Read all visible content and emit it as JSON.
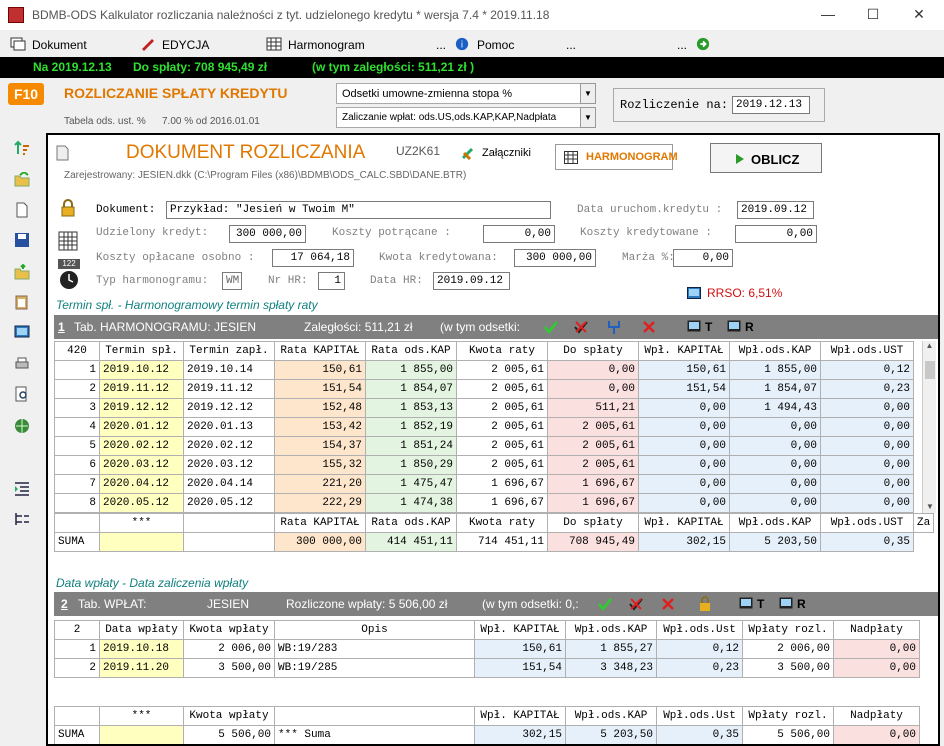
{
  "window": {
    "title": "BDMB-ODS Kalkulator rozliczania należności z tyt. udzielonego kredytu * wersja 7.4 * 2019.11.18",
    "min": "—",
    "max": "☐",
    "close": "✕"
  },
  "menu": {
    "dokument": "Dokument",
    "edycja": "EDYCJA",
    "harmonogram": "Harmonogram",
    "dots1": "...",
    "pomoc": "Pomoc",
    "dots2": "...",
    "dots3": "..."
  },
  "status": {
    "date": "Na 2019.12.13",
    "do_splaty": "Do spłaty: 708 945,49 zł",
    "zaleglosci": "(w tym zaległości: 511,21 zł )"
  },
  "header": {
    "f10": "F10",
    "title": "ROZLICZANIE SPŁATY KREDYTU",
    "odsetki_combo": "Odsetki umowne-zmienna stopa %",
    "zaliczanie_combo": "Zaliczanie wpłat: ods.US,ods.KAP,KAP,Nadpłata",
    "tabela_label": "Tabela ods. ust. %",
    "tabela_value": "7.00 % od 2016.01.01",
    "rozliczenie_label": "Rozliczenie na:",
    "rozliczenie_value": "2019.12.13"
  },
  "doc": {
    "title": "DOKUMENT ROZLICZANIA",
    "code": "UZ2K61",
    "zalaczniki": "Załączniki",
    "harmonogram_btn": "HARMONOGRAM",
    "oblicz_btn": "OBLICZ",
    "registered": "Zarejestrowany: JESIEN.dkk (C:\\Program Files (x86)\\BDMB\\ODS_CALC.SBD\\DANE.BTR)"
  },
  "form": {
    "dokument_label": "Dokument:",
    "dokument_value": "Przykład: \"Jesień w Twoim M\"",
    "data_uruch_label": "Data uruchom.kredytu :",
    "data_uruch_value": "2019.09.12",
    "udzielony_label": "Udzielony kredyt:",
    "udzielony_value": "300 000,00",
    "koszty_potr_label": "Koszty potrącane  :",
    "koszty_potr_value": "0,00",
    "koszty_kred_label": "Koszty kredytowane :",
    "koszty_kred_value": "0,00",
    "koszty_opl_label": "Koszty opłacane osobno :",
    "koszty_opl_value": "17 064,18",
    "kwota_kred_label": "Kwota kredytowana:",
    "kwota_kred_value": "300 000,00",
    "marza_label": "Marża %:",
    "marza_value": "0,00",
    "typ_label": "Typ harmonogramu:",
    "typ_value": "WM",
    "nr_label": "Nr HR:",
    "nr_value": "1",
    "data_hr_label": "Data HR:",
    "data_hr_value": "2019.09.12",
    "rrso": "RRSO: 6,51%",
    "calc_icon_text": "122"
  },
  "harm": {
    "caption": "Termin spł. -   Harmonogramowy termin spłaty raty",
    "num": "1",
    "title": "Tab. HARMONOGRAMU:  JESIEN",
    "zal": "Zaległości: 511,21 zł",
    "odsetki": "(w tym odsetki:",
    "t": "T",
    "r": "R",
    "headers": [
      "420",
      "Termin spł.",
      "Termin zapł.",
      "Rata KAPITAŁ",
      "Rata ods.KAP",
      "Kwota raty",
      "Do spłaty",
      "Wpł. KAPITAŁ",
      "Wpł.ods.KAP",
      "Wpł.ods.UST"
    ],
    "rows": [
      [
        "1",
        "2019.10.12",
        "2019.10.14",
        "150,61",
        "1 855,00",
        "2 005,61",
        "0,00",
        "150,61",
        "1 855,00",
        "0,12"
      ],
      [
        "2",
        "2019.11.12",
        "2019.11.12",
        "151,54",
        "1 854,07",
        "2 005,61",
        "0,00",
        "151,54",
        "1 854,07",
        "0,23"
      ],
      [
        "3",
        "2019.12.12",
        "2019.12.12",
        "152,48",
        "1 853,13",
        "2 005,61",
        "511,21",
        "0,00",
        "1 494,43",
        "0,00"
      ],
      [
        "4",
        "2020.01.12",
        "2020.01.13",
        "153,42",
        "1 852,19",
        "2 005,61",
        "2 005,61",
        "0,00",
        "0,00",
        "0,00"
      ],
      [
        "5",
        "2020.02.12",
        "2020.02.12",
        "154,37",
        "1 851,24",
        "2 005,61",
        "2 005,61",
        "0,00",
        "0,00",
        "0,00"
      ],
      [
        "6",
        "2020.03.12",
        "2020.03.12",
        "155,32",
        "1 850,29",
        "2 005,61",
        "2 005,61",
        "0,00",
        "0,00",
        "0,00"
      ],
      [
        "7",
        "2020.04.12",
        "2020.04.14",
        "221,20",
        "1 475,47",
        "1 696,67",
        "1 696,67",
        "0,00",
        "0,00",
        "0,00"
      ],
      [
        "8",
        "2020.05.12",
        "2020.05.12",
        "222,29",
        "1 474,38",
        "1 696,67",
        "1 696,67",
        "0,00",
        "0,00",
        "0,00"
      ]
    ],
    "sum_headers": [
      "",
      "***",
      "",
      "Rata KAPITAŁ",
      "Rata ods.KAP",
      "Kwota raty",
      "Do spłaty",
      "Wpł. KAPITAŁ",
      "Wpł.ods.KAP",
      "Wpł.ods.UST",
      "Za"
    ],
    "sum_row": [
      "SUMA",
      "",
      "",
      "300 000,00",
      "414 451,11",
      "714 451,11",
      "708 945,49",
      "302,15",
      "5 203,50",
      "0,35"
    ]
  },
  "wpl": {
    "caption": "Data wpłaty -   Data zaliczenia wpłaty",
    "num": "2",
    "title": "Tab. WPŁAT:",
    "name": "JESIEN",
    "rozl": "Rozliczone wpłaty: 5 506,00 zł",
    "odsetki": "(w tym odsetki: 0,:",
    "t": "T",
    "r": "R",
    "headers": [
      "2",
      "Data wpłaty",
      "Kwota wpłaty",
      "Opis",
      "Wpł. KAPITAŁ",
      "Wpł.ods.KAP",
      "Wpł.ods.Ust",
      "Wpłaty rozl.",
      "Nadpłaty"
    ],
    "rows": [
      [
        "1",
        "2019.10.18",
        "2 006,00",
        "WB:19/283",
        "150,61",
        "1 855,27",
        "0,12",
        "2 006,00",
        "0,00"
      ],
      [
        "2",
        "2019.11.20",
        "3 500,00",
        "WB:19/285",
        "151,54",
        "3 348,23",
        "0,23",
        "3 500,00",
        "0,00"
      ]
    ],
    "sum_headers": [
      "",
      "***",
      "Kwota wpłaty",
      "",
      "Wpł. KAPITAŁ",
      "Wpł.ods.KAP",
      "Wpł.ods.Ust",
      "Wpłaty rozl.",
      "Nadpłaty"
    ],
    "sum_row": [
      "SUMA",
      "",
      "5 506,00",
      "*** Suma",
      "302,15",
      "5 203,50",
      "0,35",
      "5 506,00",
      "0,00"
    ]
  }
}
